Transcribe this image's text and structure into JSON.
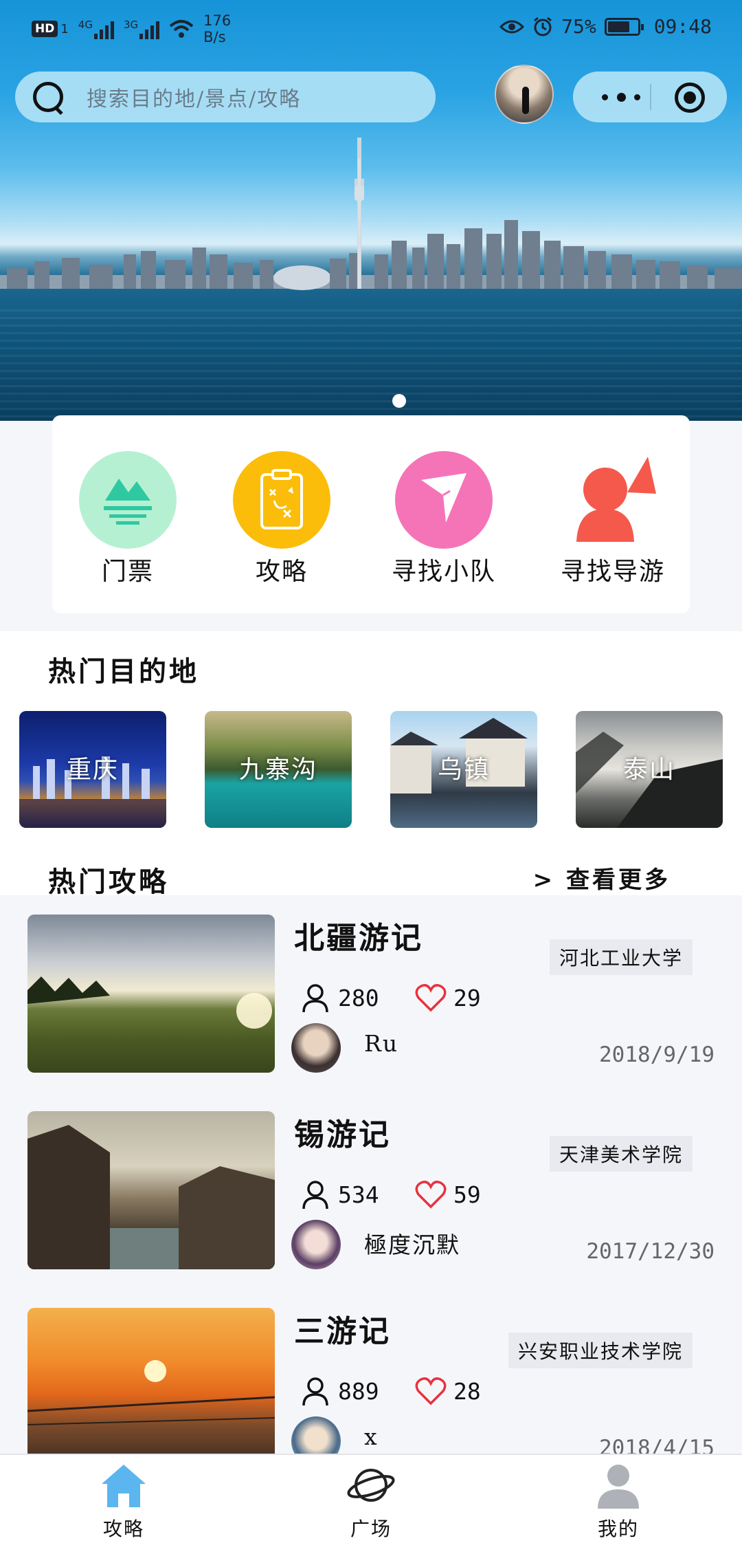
{
  "status_bar": {
    "hd": "HD",
    "sim": "1",
    "net_4g": "4G",
    "net_3g": "3G",
    "speed_value": "176",
    "speed_unit": "B/s",
    "battery": "75%",
    "battery_level": 0.75,
    "time": "09:48"
  },
  "search": {
    "placeholder": "搜索目的地/景点/攻略"
  },
  "banner": {
    "slide_count": 1,
    "active_slide": 1
  },
  "quick_entries": [
    {
      "label": "门票",
      "icon": "mountain-ticket-icon",
      "color": "#b6f0d3"
    },
    {
      "label": "攻略",
      "icon": "clipboard-strategy-icon",
      "color": "#fbbd0a"
    },
    {
      "label": "寻找小队",
      "icon": "team-flag-icon",
      "color": "#f574b8"
    },
    {
      "label": "寻找导游",
      "icon": "guide-person-icon",
      "color": "#f5594c"
    }
  ],
  "hot_destinations": {
    "title": "热门目的地",
    "items": [
      {
        "name": "重庆"
      },
      {
        "name": "九寨沟"
      },
      {
        "name": "乌镇"
      },
      {
        "name": "泰山"
      }
    ]
  },
  "hot_guides": {
    "title": "热门攻略",
    "more_label": "> 查看更多",
    "items": [
      {
        "title": "北疆游记",
        "school": "河北工业大学",
        "views": "280",
        "likes": "29",
        "user": "Ru",
        "date": "2018/9/19"
      },
      {
        "title": "锡游记",
        "school": "天津美术学院",
        "views": "534",
        "likes": "59",
        "user": "極度沉默",
        "date": "2017/12/30"
      },
      {
        "title": "三游记",
        "school": "兴安职业技术学院",
        "views": "889",
        "likes": "28",
        "user": "x",
        "date": "2018/4/15"
      }
    ]
  },
  "tabbar": {
    "active_color": "#5bb6f0",
    "items": [
      {
        "label": "攻略",
        "icon": "home-icon",
        "active": true
      },
      {
        "label": "广场",
        "icon": "planet-icon",
        "active": false
      },
      {
        "label": "我的",
        "icon": "user-icon",
        "active": false
      }
    ]
  }
}
